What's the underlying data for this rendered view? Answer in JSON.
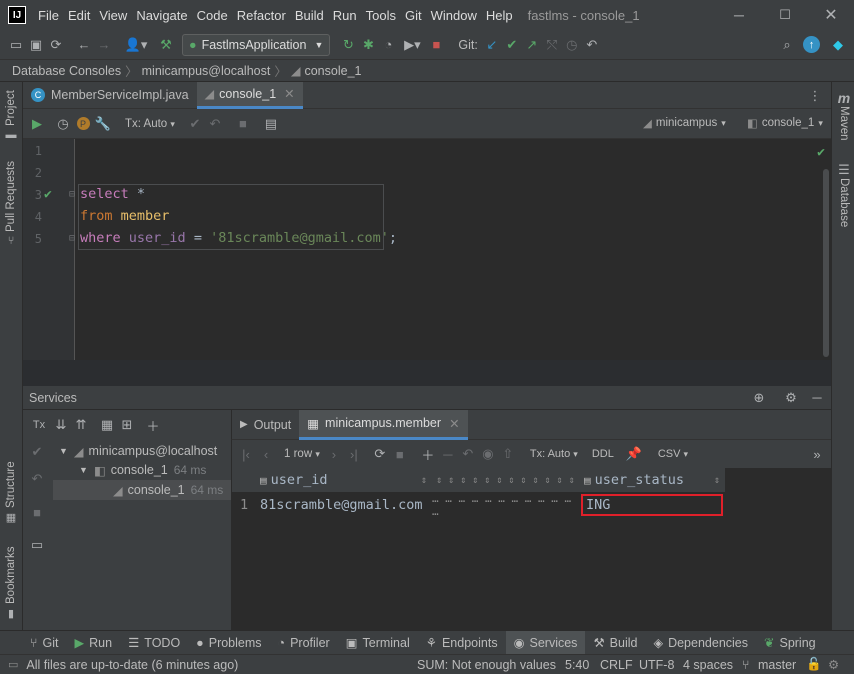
{
  "window": {
    "title": "fastlms - console_1",
    "menu": [
      "File",
      "Edit",
      "View",
      "Navigate",
      "Code",
      "Refactor",
      "Build",
      "Run",
      "Tools",
      "Git",
      "Window",
      "Help"
    ]
  },
  "toolbar": {
    "run_config": "FastlmsApplication",
    "git_label": "Git:"
  },
  "breadcrumb": [
    "Database Consoles",
    "minicampus@localhost",
    "console_1"
  ],
  "left_stripe": [
    "Project",
    "Pull Requests",
    "Structure",
    "Bookmarks"
  ],
  "right_stripe": [
    "Maven",
    "Database"
  ],
  "editor_tabs": [
    {
      "label": "MemberServiceImpl.java",
      "active": false
    },
    {
      "label": "console_1",
      "active": true
    }
  ],
  "console_toolbar": {
    "tx_mode": "Tx: Auto",
    "datasource": "minicampus",
    "session": "console_1"
  },
  "editor": {
    "line_numbers": [
      "1",
      "2",
      "3",
      "4",
      "5"
    ],
    "lines": [
      {
        "kw": "select",
        "rest": " *"
      },
      {
        "kw": "from",
        "rest": " member"
      },
      {
        "kw": "where",
        "col": "user_id",
        "op": " = ",
        "str": "'81scramble@gmail.com'",
        "end": ";"
      }
    ]
  },
  "services": {
    "title": "Services",
    "tree": [
      {
        "label": "minicampus@localhost",
        "time": ""
      },
      {
        "label": "console_1",
        "time": "64 ms"
      },
      {
        "label": "console_1",
        "time": "64 ms"
      }
    ],
    "tabs": [
      {
        "label": "Output",
        "active": false
      },
      {
        "label": "minicampus.member",
        "active": true
      }
    ],
    "grid_toolbar": {
      "rows": "1 row",
      "tx": "Tx: Auto",
      "ddl": "DDL",
      "export": "CSV"
    },
    "grid": {
      "columns": [
        "user_id",
        "user_status"
      ],
      "rows": [
        {
          "num": "1",
          "user_id": "81scramble@gmail.com",
          "ellipsis": "… … … … … … … … … … … …",
          "user_status": "ING"
        }
      ]
    }
  },
  "tool_windows": [
    {
      "label": "Git",
      "icon": "git-icon",
      "active": false
    },
    {
      "label": "Run",
      "icon": "run-icon",
      "active": false
    },
    {
      "label": "TODO",
      "icon": "todo-icon",
      "active": false
    },
    {
      "label": "Problems",
      "icon": "problems-icon",
      "active": false
    },
    {
      "label": "Profiler",
      "icon": "profiler-icon",
      "active": false
    },
    {
      "label": "Terminal",
      "icon": "terminal-icon",
      "active": false
    },
    {
      "label": "Endpoints",
      "icon": "endpoints-icon",
      "active": false
    },
    {
      "label": "Services",
      "icon": "services-icon",
      "active": true
    },
    {
      "label": "Build",
      "icon": "build-icon",
      "active": false
    },
    {
      "label": "Dependencies",
      "icon": "dependencies-icon",
      "active": false
    },
    {
      "label": "Spring",
      "icon": "spring-icon",
      "active": false
    }
  ],
  "status": {
    "message": "All files are up-to-date (6 minutes ago)",
    "sum": "SUM: Not enough values",
    "position": "5:40",
    "line_sep": "CRLF",
    "encoding": "UTF-8",
    "indent": "4 spaces",
    "branch": "master"
  },
  "colors": {
    "accent": "#4a88c7",
    "highlight_box": "#e0202a",
    "run_green": "#499c54"
  }
}
